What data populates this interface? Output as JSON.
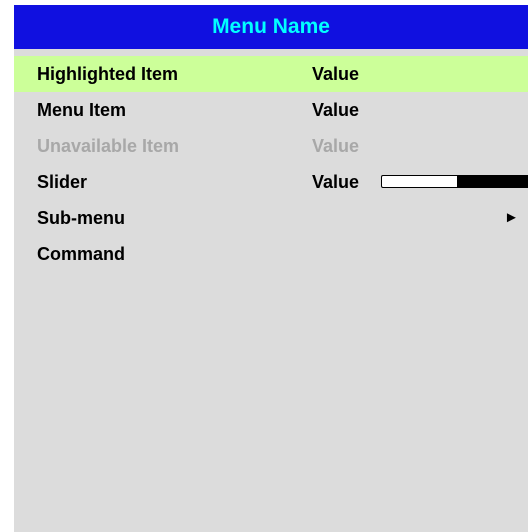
{
  "menu": {
    "title": "Menu Name",
    "colors": {
      "header_background": "#1010e0",
      "header_text": "#00ffff",
      "body_background": "#dcdcdc",
      "highlight_background": "#ccff99",
      "disabled_text": "#a8a8a8"
    },
    "items": [
      {
        "label": "Highlighted Item",
        "value": "Value",
        "state": "highlighted"
      },
      {
        "label": "Menu Item",
        "value": "Value",
        "state": "normal"
      },
      {
        "label": "Unavailable Item",
        "value": "Value",
        "state": "disabled"
      },
      {
        "label": "Slider",
        "value": "Value",
        "state": "normal",
        "slider_level": 0.48
      },
      {
        "label": "Sub-menu",
        "state": "normal",
        "icon": "triangle-right-icon",
        "arrow": "►"
      },
      {
        "label": "Command",
        "state": "normal"
      }
    ]
  }
}
